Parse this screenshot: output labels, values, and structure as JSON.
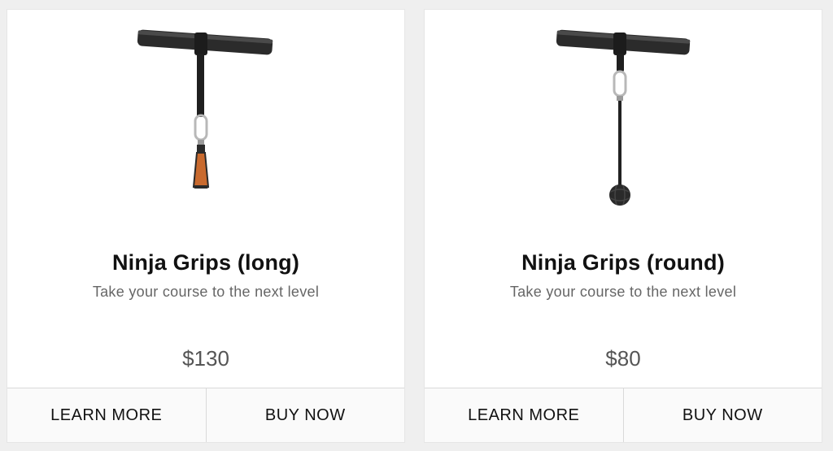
{
  "products": [
    {
      "title": "Ninja Grips (long)",
      "subtitle": "Take your course to the next level",
      "price": "$130",
      "learn_more_label": "LEARN MORE",
      "buy_now_label": "BUY NOW",
      "grip_style": "long",
      "grip_color": "#c96a2e"
    },
    {
      "title": "Ninja Grips (round)",
      "subtitle": "Take your course to the next level",
      "price": "$80",
      "learn_more_label": "LEARN MORE",
      "buy_now_label": "BUY NOW",
      "grip_style": "round",
      "grip_color": "#2a2a2a"
    }
  ]
}
